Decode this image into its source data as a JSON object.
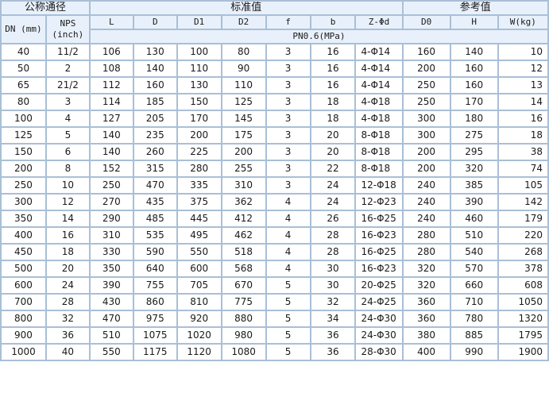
{
  "table": {
    "groups": {
      "nominal": "公称通径",
      "standard": "标准值",
      "reference": "参考值"
    },
    "header": {
      "dn": "DN (mm)",
      "nps_line1": "NPS",
      "nps_line2": "(inch)",
      "standard_cols": [
        "L",
        "D",
        "D1",
        "D2",
        "f",
        "b",
        "Z-Φd"
      ],
      "reference_cols": [
        "D0",
        "H",
        "W(kg)"
      ],
      "pressure": "PN0.6(MPa)"
    },
    "rows": [
      [
        "40",
        "11/2",
        "106",
        "130",
        "100",
        "80",
        "3",
        "16",
        "4-Φ14",
        "160",
        "140",
        "10"
      ],
      [
        "50",
        "2",
        "108",
        "140",
        "110",
        "90",
        "3",
        "16",
        "4-Φ14",
        "200",
        "160",
        "12"
      ],
      [
        "65",
        "21/2",
        "112",
        "160",
        "130",
        "110",
        "3",
        "16",
        "4-Φ14",
        "250",
        "160",
        "13"
      ],
      [
        "80",
        "3",
        "114",
        "185",
        "150",
        "125",
        "3",
        "18",
        "4-Φ18",
        "250",
        "170",
        "14"
      ],
      [
        "100",
        "4",
        "127",
        "205",
        "170",
        "145",
        "3",
        "18",
        "4-Φ18",
        "300",
        "180",
        "16"
      ],
      [
        "125",
        "5",
        "140",
        "235",
        "200",
        "175",
        "3",
        "20",
        "8-Φ18",
        "300",
        "275",
        "18"
      ],
      [
        "150",
        "6",
        "140",
        "260",
        "225",
        "200",
        "3",
        "20",
        "8-Φ18",
        "200",
        "295",
        "38"
      ],
      [
        "200",
        "8",
        "152",
        "315",
        "280",
        "255",
        "3",
        "22",
        "8-Φ18",
        "200",
        "320",
        "74"
      ],
      [
        "250",
        "10",
        "250",
        "470",
        "335",
        "310",
        "3",
        "24",
        "12-Φ18",
        "240",
        "385",
        "105"
      ],
      [
        "300",
        "12",
        "270",
        "435",
        "375",
        "362",
        "4",
        "24",
        "12-Φ23",
        "240",
        "390",
        "142"
      ],
      [
        "350",
        "14",
        "290",
        "485",
        "445",
        "412",
        "4",
        "26",
        "16-Φ25",
        "240",
        "460",
        "179"
      ],
      [
        "400",
        "16",
        "310",
        "535",
        "495",
        "462",
        "4",
        "28",
        "16-Φ23",
        "280",
        "510",
        "220"
      ],
      [
        "450",
        "18",
        "330",
        "590",
        "550",
        "518",
        "4",
        "28",
        "16-Φ25",
        "280",
        "540",
        "268"
      ],
      [
        "500",
        "20",
        "350",
        "640",
        "600",
        "568",
        "4",
        "30",
        "16-Φ23",
        "320",
        "570",
        "378"
      ],
      [
        "600",
        "24",
        "390",
        "755",
        "705",
        "670",
        "5",
        "30",
        "20-Φ25",
        "320",
        "660",
        "608"
      ],
      [
        "700",
        "28",
        "430",
        "860",
        "810",
        "775",
        "5",
        "32",
        "24-Φ25",
        "360",
        "710",
        "1050"
      ],
      [
        "800",
        "32",
        "470",
        "975",
        "920",
        "880",
        "5",
        "34",
        "24-Φ30",
        "360",
        "780",
        "1320"
      ],
      [
        "900",
        "36",
        "510",
        "1075",
        "1020",
        "980",
        "5",
        "36",
        "24-Φ30",
        "380",
        "885",
        "1795"
      ],
      [
        "1000",
        "40",
        "550",
        "1175",
        "1120",
        "1080",
        "5",
        "36",
        "28-Φ30",
        "400",
        "990",
        "1900"
      ]
    ]
  }
}
